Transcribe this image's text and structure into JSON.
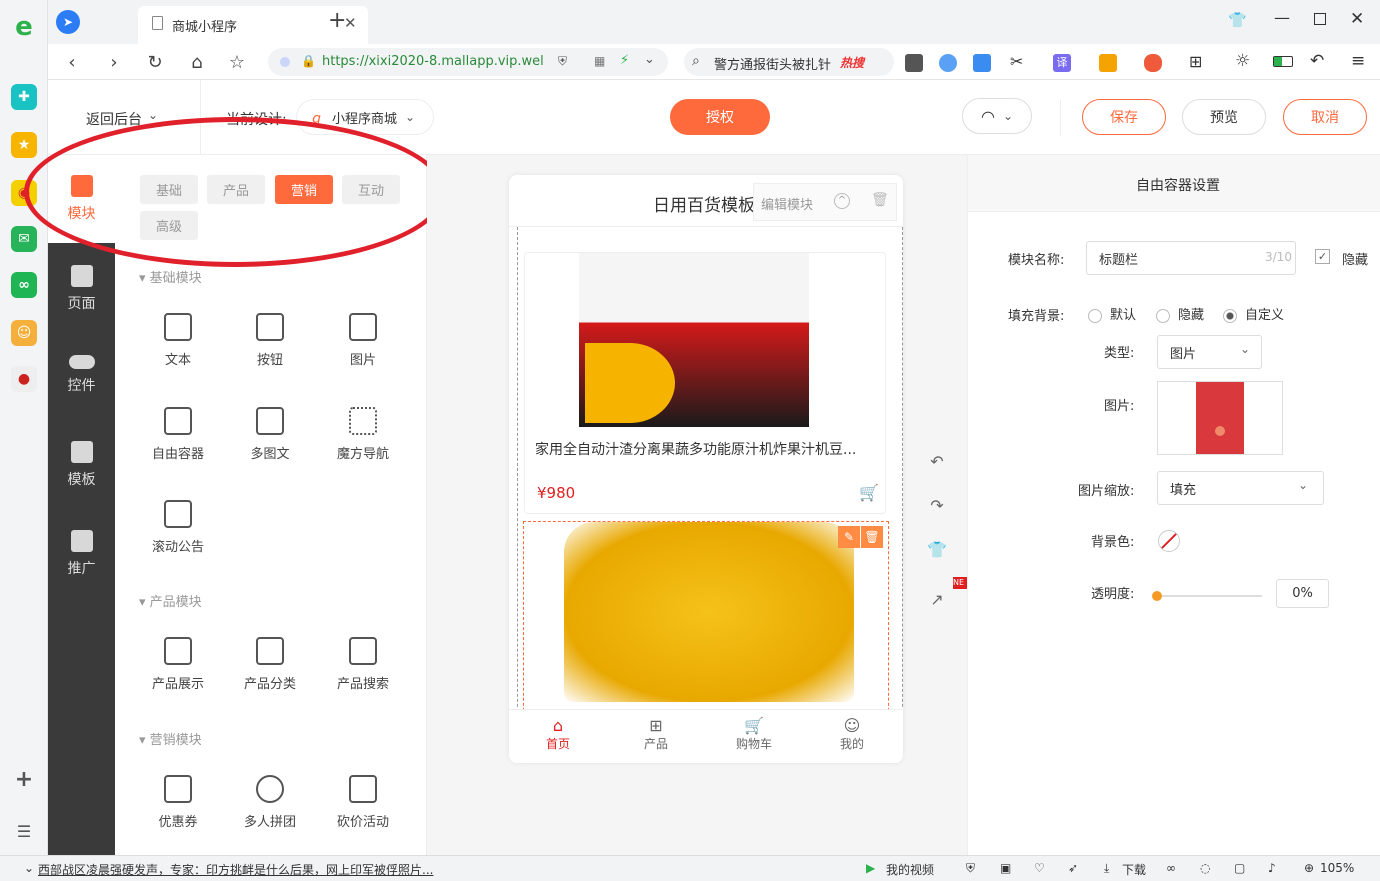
{
  "browser": {
    "tab_title": "商城小程序",
    "url": "https://xixi2020-8.mallapp.vip.wel",
    "search_text": "警方通报街头被扎针",
    "search_badge": "热搜"
  },
  "header": {
    "back_label": "返回后台",
    "current_design_label": "当前设计:",
    "design_name": "小程序商城",
    "authorize_label": "授权",
    "save_label": "保存",
    "preview_label": "预览",
    "cancel_label": "取消"
  },
  "leftnav": {
    "items": [
      {
        "label": "模块"
      },
      {
        "label": "页面"
      },
      {
        "label": "控件"
      },
      {
        "label": "模板"
      },
      {
        "label": "推广"
      }
    ]
  },
  "modpanel": {
    "tabs": [
      "基础",
      "产品",
      "营销",
      "互动",
      "高级"
    ],
    "active_tab": "营销",
    "sections": [
      {
        "title": "基础模块",
        "items": [
          "文本",
          "按钮",
          "图片",
          "自由容器",
          "多图文",
          "魔方导航",
          "滚动公告"
        ]
      },
      {
        "title": "产品模块",
        "items": [
          "产品展示",
          "产品分类",
          "产品搜索"
        ]
      },
      {
        "title": "营销模块",
        "items": [
          "优惠券",
          "多人拼团",
          "砍价活动"
        ]
      }
    ]
  },
  "phone": {
    "title": "日用百货模板",
    "edit_module_label": "编辑模块",
    "product_name": "家用全自动汁渣分离果蔬多功能原汁机炸果汁机豆...",
    "product_price": "¥980",
    "bottom_tabs": [
      "首页",
      "产品",
      "购物车",
      "我的"
    ],
    "side_badge": "NE"
  },
  "rightpanel": {
    "title": "自由容器设置",
    "module_name_label": "模块名称:",
    "module_name_value": "标题栏",
    "module_name_count": "3/10",
    "hide_label": "隐藏",
    "fill_bg_label": "填充背景:",
    "fill_options": [
      "默认",
      "隐藏",
      "自定义"
    ],
    "fill_selected": "自定义",
    "type_label": "类型:",
    "type_value": "图片",
    "image_label": "图片:",
    "scale_label": "图片缩放:",
    "scale_value": "填充",
    "bgcolor_label": "背景色:",
    "opacity_label": "透明度:",
    "opacity_value": "0%"
  },
  "statusbar": {
    "news": "西部战区凌晨强硬发声，专家：印方挑衅是什么后果，网上印军被俘照片...",
    "my_video": "我的视频",
    "download": "下载",
    "zoom": "105%"
  },
  "colors": {
    "accent": "#ff6a3d",
    "dark_nav": "#3a3a3a",
    "price": "#e02020",
    "annotation": "#e0202a"
  }
}
